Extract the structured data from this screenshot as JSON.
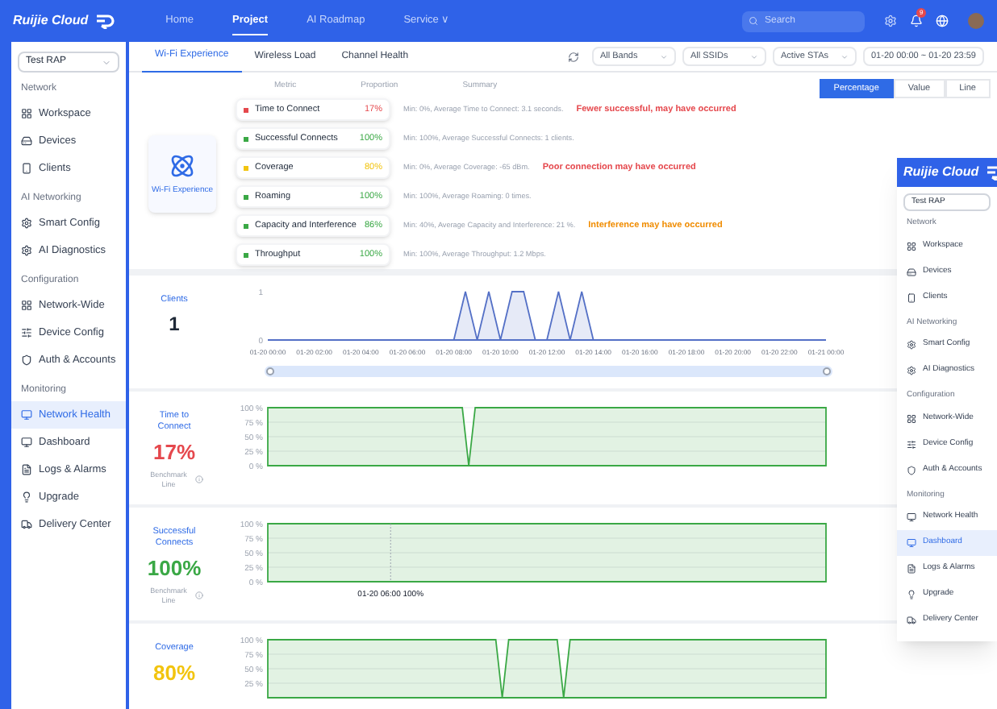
{
  "header": {
    "logo": "Ruijie Cloud",
    "nav": [
      {
        "label": "Home",
        "selected": false
      },
      {
        "label": "Project",
        "selected": true
      },
      {
        "label": "AI Roadmap",
        "selected": false
      },
      {
        "label": "Service ∨",
        "selected": false
      }
    ],
    "search": {
      "placeholder": "Search"
    },
    "badge": "9"
  },
  "sidebar": {
    "project": "Test RAP",
    "sections": [
      {
        "title": "Network",
        "items": [
          {
            "label": "Workspace",
            "selected": false
          },
          {
            "label": "Devices",
            "selected": false
          },
          {
            "label": "Clients",
            "selected": false
          }
        ]
      },
      {
        "title": "AI Networking",
        "items": [
          {
            "label": "Smart Config",
            "selected": false
          },
          {
            "label": "AI Diagnostics",
            "selected": false
          }
        ]
      },
      {
        "title": "Configuration",
        "items": [
          {
            "label": "Network-Wide",
            "selected": false
          },
          {
            "label": "Device Config",
            "selected": false
          },
          {
            "label": "Auth & Accounts",
            "selected": false
          }
        ]
      },
      {
        "title": "Monitoring",
        "items": [
          {
            "label": "Network Health",
            "selected": true
          },
          {
            "label": "Dashboard",
            "selected": false
          },
          {
            "label": "Logs & Alarms",
            "selected": false
          },
          {
            "label": "Upgrade",
            "selected": false
          },
          {
            "label": "Delivery Center",
            "selected": false
          }
        ]
      }
    ]
  },
  "tabs": [
    {
      "label": "Wi-Fi Experience",
      "selected": true
    },
    {
      "label": "Wireless Load",
      "selected": false
    },
    {
      "label": "Channel Health",
      "selected": false
    }
  ],
  "filters": {
    "band": "All Bands",
    "ssid": "All SSIDs",
    "sta": "Active STAs",
    "time_range": "01-20 00:00 ~ 01-20 23:59"
  },
  "view_toggle": [
    {
      "label": "Percentage",
      "selected": true
    },
    {
      "label": "Value",
      "selected": false
    },
    {
      "label": "Line",
      "selected": false
    }
  ],
  "overview": {
    "title": "Wi-Fi Experience",
    "columns": [
      "Metric",
      "Proportion",
      "Summary"
    ],
    "metrics": [
      {
        "name": "Time to Connect",
        "value": "17%",
        "color": "#e5484d",
        "summary": "Min: 0%, Average Time to Connect: 3.1 seconds.",
        "warning": {
          "text": "Fewer successful, may have occurred",
          "color": "#e5484d"
        }
      },
      {
        "name": "Successful Connects",
        "value": "100%",
        "color": "#3aa845",
        "summary": "Min: 100%, Average Successful Connects: 1 clients."
      },
      {
        "name": "Coverage",
        "value": "80%",
        "color": "#f2c40f",
        "summary": "Min: 0%, Average Coverage: -65 dBm.",
        "warning": {
          "text": "Poor connection may have occurred",
          "color": "#e5484d"
        }
      },
      {
        "name": "Roaming",
        "value": "100%",
        "color": "#3aa845",
        "summary": "Min: 100%, Average Roaming: 0 times."
      },
      {
        "name": "Capacity and Interference",
        "value": "86%",
        "color": "#3aa845",
        "summary": "Min: 40%, Average Capacity and Interference: 21 %.",
        "warning": {
          "text": "Interference may have occurred",
          "color": "#f08c00"
        }
      },
      {
        "name": "Throughput",
        "value": "100%",
        "color": "#3aa845",
        "summary": "Min: 100%, Average Throughput: 1.2 Mbps."
      }
    ]
  },
  "charts": [
    {
      "kind": "count",
      "title": "Clients",
      "value": "1",
      "color": "#1f2937",
      "chart_data": {
        "type": "area",
        "categories": [
          "01-20 00:00",
          null,
          null,
          null,
          "01-20 02:00",
          null,
          null,
          null,
          "01-20 04:00",
          null,
          null,
          null,
          "01-20 06:00",
          null,
          null,
          null,
          "01-20 08:00",
          null,
          null,
          null,
          "01-20 10:00",
          null,
          null,
          null,
          "01-20 12:00",
          null,
          null,
          null,
          "01-20 14:00",
          null,
          null,
          null,
          "01-20 16:00",
          null,
          null,
          null,
          "01-20 18:00",
          null,
          null,
          null,
          "01-20 20:00",
          null,
          null,
          null,
          "01-20 22:00",
          null,
          null,
          null,
          "01-21 00:00"
        ],
        "ylim": [
          0,
          1
        ],
        "yticks": [
          0,
          1
        ],
        "series": [
          {
            "color": "#5470c6",
            "values": [
              0,
              0,
              0,
              0,
              0,
              0,
              0,
              0,
              0,
              0,
              0,
              0,
              0,
              0,
              0,
              0,
              0,
              1,
              0,
              1,
              0,
              1,
              1,
              0,
              0,
              1,
              0,
              1,
              0,
              0,
              0,
              0,
              0,
              0,
              0,
              0,
              0,
              0,
              0,
              0,
              0,
              0,
              0,
              0,
              0,
              0,
              0,
              0,
              0
            ]
          }
        ]
      }
    },
    {
      "kind": "percent",
      "title": "Time to Connect",
      "value": "17%",
      "color": "#e5484d",
      "note": "Benchmark Line",
      "axis_labels": [
        "100 %",
        "75 %",
        "50 %",
        "25 %",
        "0 %"
      ]
    },
    {
      "kind": "percent",
      "title": "Successful Connects",
      "value": "100%",
      "color": "#3aa845",
      "note": "Benchmark Line",
      "tooltip": "01-20 06:00 100%",
      "axis_labels": [
        "100 %",
        "75 %",
        "50 %",
        "25 %",
        "0 %"
      ]
    },
    {
      "kind": "percent",
      "title": "Coverage",
      "value": "80%",
      "color": "#f2c40f",
      "axis_labels": [
        "100 %",
        "75 %",
        "50 %",
        "25 %"
      ]
    }
  ],
  "overlay": {
    "logo": "Ruijie Cloud",
    "project": "Test RAP",
    "sections": [
      {
        "title": "Network",
        "items": [
          {
            "label": "Workspace",
            "selected": false
          },
          {
            "label": "Devices",
            "selected": false
          },
          {
            "label": "Clients",
            "selected": false
          }
        ]
      },
      {
        "title": "AI Networking",
        "items": [
          {
            "label": "Smart Config",
            "selected": false
          },
          {
            "label": "AI Diagnostics",
            "selected": false
          }
        ]
      },
      {
        "title": "Configuration",
        "items": [
          {
            "label": "Network-Wide",
            "selected": false
          },
          {
            "label": "Device Config",
            "selected": false
          },
          {
            "label": "Auth & Accounts",
            "selected": false
          }
        ]
      },
      {
        "title": "Monitoring",
        "items": [
          {
            "label": "Network Health",
            "selected": false
          },
          {
            "label": "Dashboard",
            "selected": true
          },
          {
            "label": "Logs & Alarms",
            "selected": false
          },
          {
            "label": "Upgrade",
            "selected": false
          },
          {
            "label": "Delivery Center",
            "selected": false
          }
        ]
      }
    ]
  }
}
